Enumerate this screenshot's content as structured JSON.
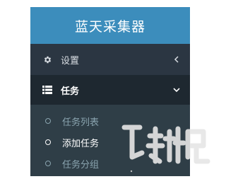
{
  "app": {
    "title": "蓝天采集器"
  },
  "menu": {
    "settings": {
      "label": "设置",
      "icon": "gear-icon",
      "chevron": "chevron-left-icon"
    },
    "tasks": {
      "label": "任务",
      "icon": "list-icon",
      "chevron": "chevron-down-icon",
      "expanded": true,
      "items": [
        {
          "label": "任务列表",
          "active": false
        },
        {
          "label": "添加任务",
          "active": true
        },
        {
          "label": "任务分组",
          "active": false
        }
      ]
    }
  },
  "colors": {
    "header": "#3c8dbc",
    "sidebar": "#2b3642",
    "active_row": "#1e2830",
    "submenu": "#2f3e47",
    "submenu_text": "#8aa4af"
  }
}
